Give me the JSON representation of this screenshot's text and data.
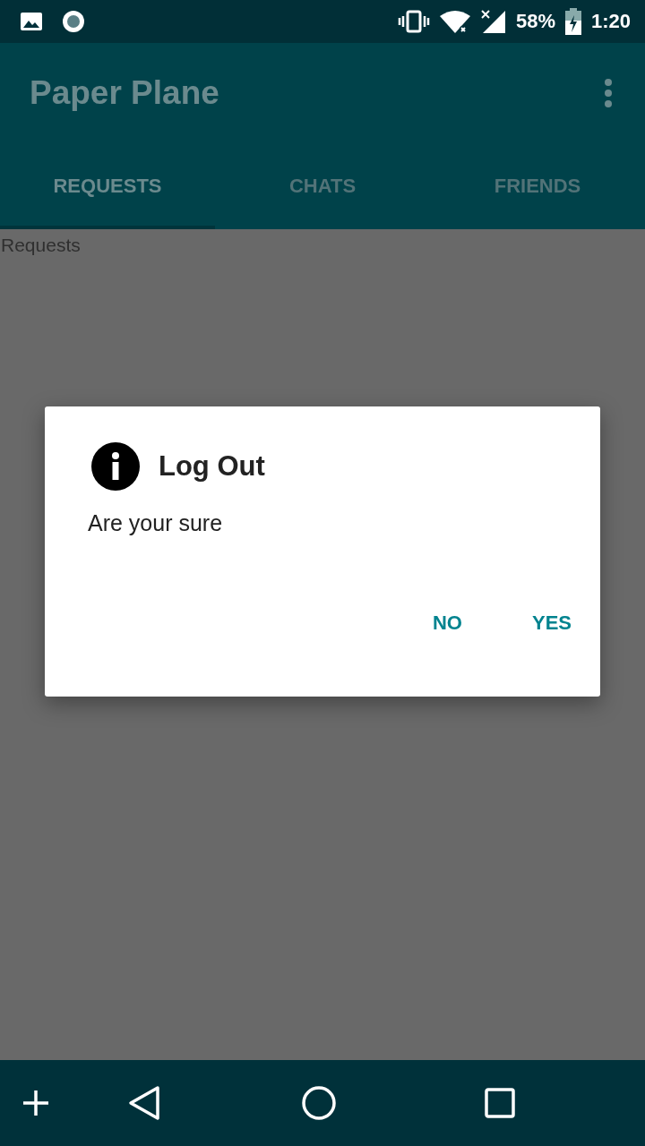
{
  "status_bar": {
    "battery": "58%",
    "time": "1:20"
  },
  "app_bar": {
    "title": "Paper Plane"
  },
  "tabs": [
    {
      "label": "REQUESTS",
      "selected": true
    },
    {
      "label": "CHATS",
      "selected": false
    },
    {
      "label": "FRIENDS",
      "selected": false
    }
  ],
  "content": {
    "text": "Requests"
  },
  "dialog": {
    "title": "Log Out",
    "message": "Are your sure",
    "buttons": [
      "NO",
      "YES"
    ]
  }
}
